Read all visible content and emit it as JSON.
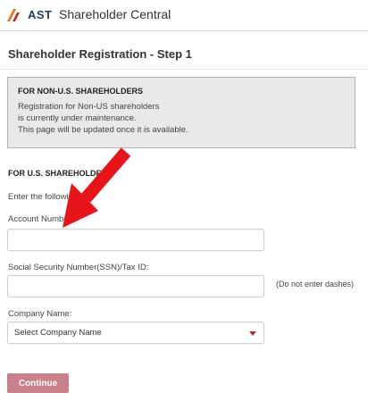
{
  "header": {
    "logo_text": "AST",
    "app_title": "Shareholder Central"
  },
  "page": {
    "title": "Shareholder Registration - Step 1"
  },
  "notice": {
    "title": "FOR NON-U.S. SHAREHOLDERS",
    "lines": [
      "Registration for Non-US shareholders",
      "is currently under maintenance.",
      "This page will be updated once it is available."
    ]
  },
  "us_section": {
    "title": "FOR U.S. SHAREHOLDERS",
    "intro": "Enter the following"
  },
  "form": {
    "account_label": "Account Number:",
    "account_value": "",
    "ssn_label": "Social Security Number(SSN)/Tax ID:",
    "ssn_value": "",
    "ssn_hint": "(Do not enter dashes)",
    "company_label": "Company Name:",
    "company_selected": "Select Company Name"
  },
  "actions": {
    "continue_label": "Continue"
  },
  "colors": {
    "brand_red": "#c0292f",
    "continue_bg": "#c98088",
    "notice_bg": "#e9e9e9",
    "annotation_arrow": "#e8141b"
  }
}
